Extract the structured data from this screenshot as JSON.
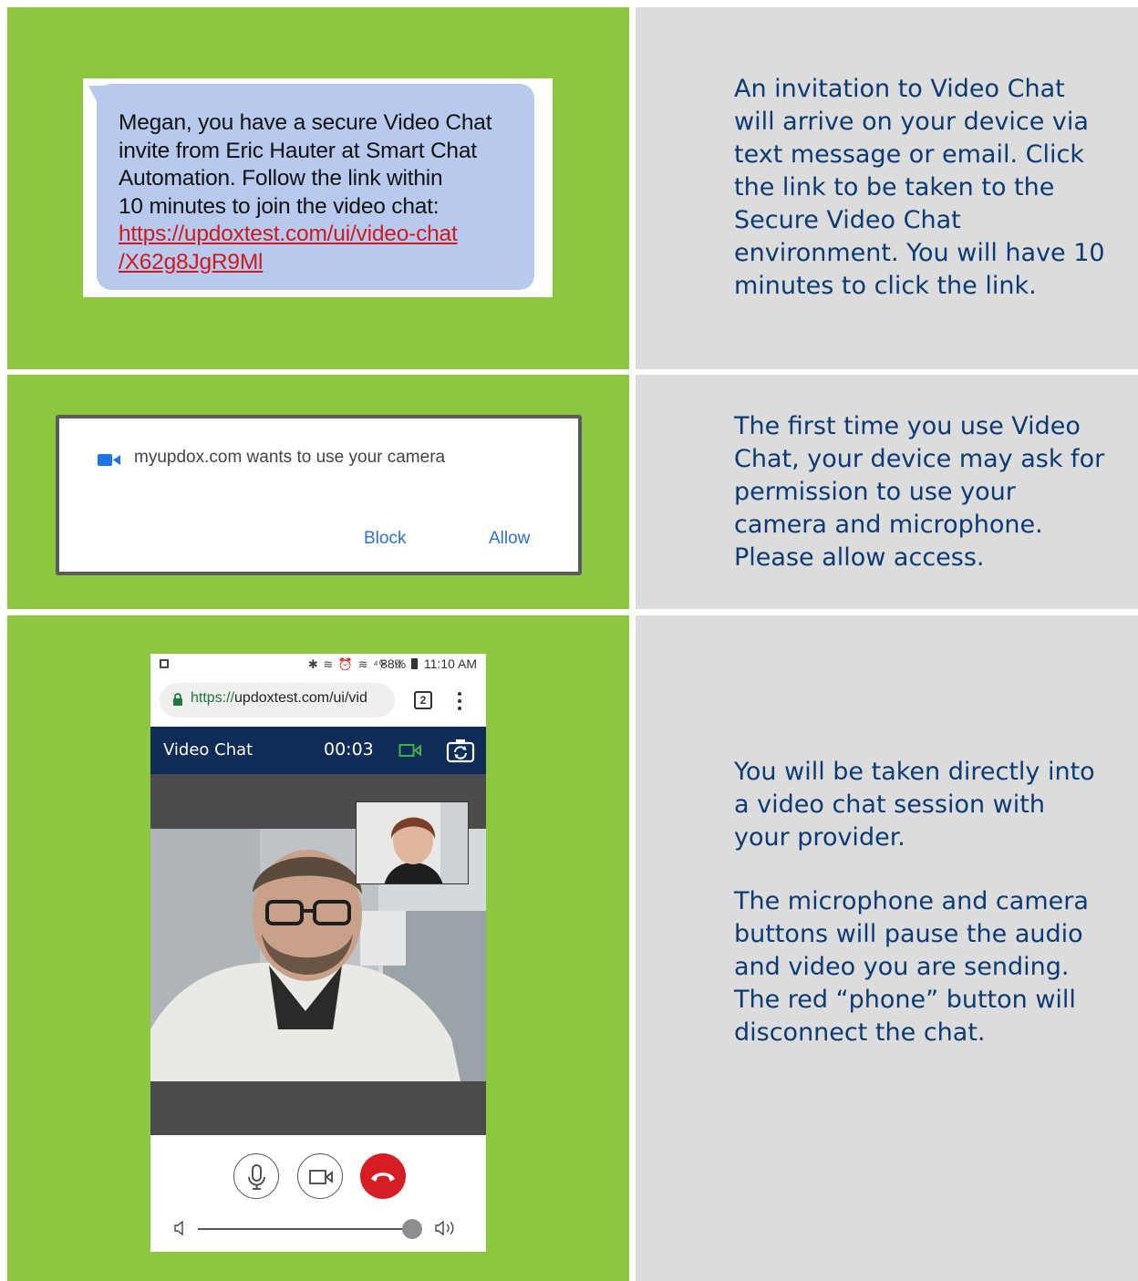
{
  "colors": {
    "green_panel": "#8dc63f",
    "grey_panel": "#dcdcdc",
    "desc_text": "#0c3a74",
    "sms_bubble": "#b7caee",
    "sms_link": "#d0181f",
    "video_header": "#0f2b57",
    "hangup_red": "#d71d24"
  },
  "step1": {
    "sms_lines": [
      "Megan, you have a secure Video Chat",
      "invite from Eric Hauter at Smart Chat",
      "Automation. Follow the link within",
      "10 minutes to join the video chat:"
    ],
    "sms_link_lines": [
      "https://updoxtest.com/ui/video-chat",
      "/X62g8JgR9Ml"
    ],
    "description": "An invitation to Video Chat\nwill arrive on your device via\ntext message or email. Click\nthe link to be taken to the\nSecure Video Chat\nenvironment. You will have 10\nminutes to click the link."
  },
  "step2": {
    "permission_text": "myupdox.com wants to use your camera",
    "block_label": "Block",
    "allow_label": "Allow",
    "camera_icon": "video-camera-icon",
    "description": "The first time you use Video\nChat, your device may ask for\npermission to use your\ncamera and microphone.\nPlease allow access."
  },
  "step3": {
    "status_bar": {
      "icons": "✱ ≋ ⏰ ≋ ⁴ᴳ .ıl",
      "battery_percent": "88%",
      "time": "11:10 AM"
    },
    "url_scheme": "https://",
    "url_rest": "updoxtest.com/ui/vid",
    "tab_count": "2",
    "header_title": "Video Chat",
    "timer": "00:03",
    "volume_level": 0.9,
    "description_part1": "You will be taken directly into\na video chat session with\nyour provider.",
    "description_part2": "The microphone and camera\nbuttons will pause the audio\nand video you are sending.\nThe red “phone” button will\ndisconnect the chat."
  }
}
